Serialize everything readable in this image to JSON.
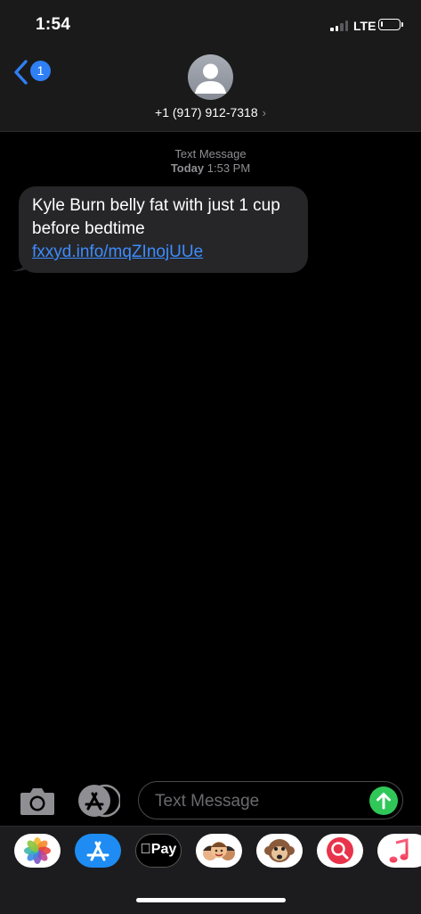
{
  "status_bar": {
    "time": "1:54",
    "network": "LTE",
    "battery_level_percent": 10
  },
  "header": {
    "unread_count": "1",
    "contact": "+1 (917) 912-7318",
    "contact_chevron": "›"
  },
  "thread": {
    "service": "Text Message",
    "day": "Today",
    "time": "1:53 PM"
  },
  "message": {
    "text": "Kyle Burn belly fat with just 1 cup before bedtime",
    "link": "fxxyd.info/mqZInojUUe"
  },
  "composer": {
    "placeholder": "Text Message",
    "icons": {
      "camera": "camera-icon",
      "apps": "app-store-icon",
      "send": "arrow-up-icon"
    }
  },
  "app_drawer": {
    "apple_pay_label": "Pay",
    "apps": [
      "photos",
      "app-store",
      "apple-pay",
      "memoji",
      "animoji",
      "web-search",
      "music"
    ]
  },
  "colors": {
    "accent": "#2f7ff5",
    "link": "#3d8cff",
    "send": "#30c759",
    "bubble": "#262628",
    "header": "#1a1a1a"
  }
}
